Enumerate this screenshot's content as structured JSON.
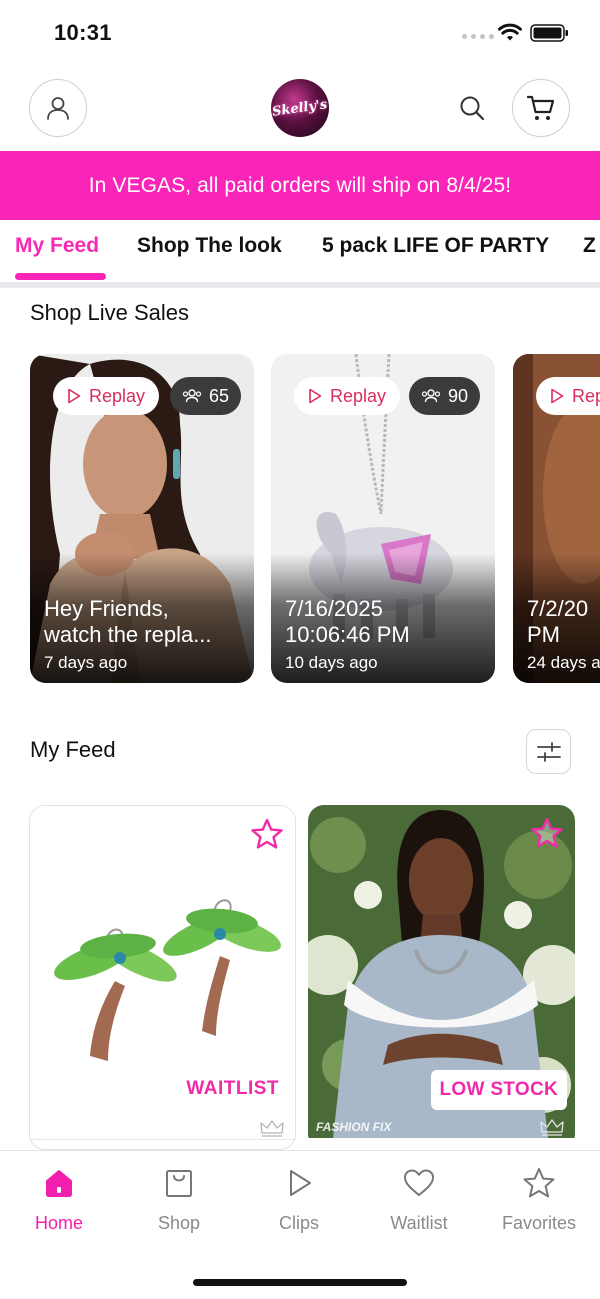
{
  "status_bar": {
    "time": "10:31"
  },
  "header": {
    "logo_text": "Skelly's",
    "logo_icon": "brand-logo"
  },
  "banner": {
    "text": "In VEGAS, all paid orders will ship on 8/4/25!"
  },
  "tabs": [
    {
      "label": "My Feed",
      "active": true
    },
    {
      "label": "Shop The look",
      "active": false
    },
    {
      "label": "5 pack LIFE OF PARTY",
      "active": false
    },
    {
      "label": "Z",
      "active": false
    }
  ],
  "live_sales": {
    "title": "Shop Live Sales",
    "cards": [
      {
        "replay": "Replay",
        "viewers": "65",
        "title_line1": "Hey Friends,",
        "title_line2": "watch the repla...",
        "time": "7 days ago"
      },
      {
        "replay": "Replay",
        "viewers": "90",
        "title_line1": "7/16/2025",
        "title_line2": "10:06:46 PM",
        "time": "10 days ago"
      },
      {
        "replay": "Rep",
        "viewers": "",
        "title_line1": "7/2/20",
        "title_line2": "PM",
        "time": "24 days a"
      }
    ]
  },
  "feed": {
    "title": "My Feed",
    "products": [
      {
        "badge": "WAITLIST",
        "watermark": ""
      },
      {
        "badge": "LOW STOCK",
        "watermark": "FASHION FIX"
      }
    ]
  },
  "colors": {
    "accent": "#fa25b8",
    "replay_text": "#d82e5e",
    "nav_inactive": "#8a8a8a"
  },
  "bottom_nav": [
    {
      "label": "Home",
      "icon": "home-icon",
      "active": true
    },
    {
      "label": "Shop",
      "icon": "shopping-bag-icon",
      "active": false
    },
    {
      "label": "Clips",
      "icon": "play-icon",
      "active": false
    },
    {
      "label": "Waitlist",
      "icon": "heart-icon",
      "active": false
    },
    {
      "label": "Favorites",
      "icon": "star-icon",
      "active": false
    }
  ]
}
